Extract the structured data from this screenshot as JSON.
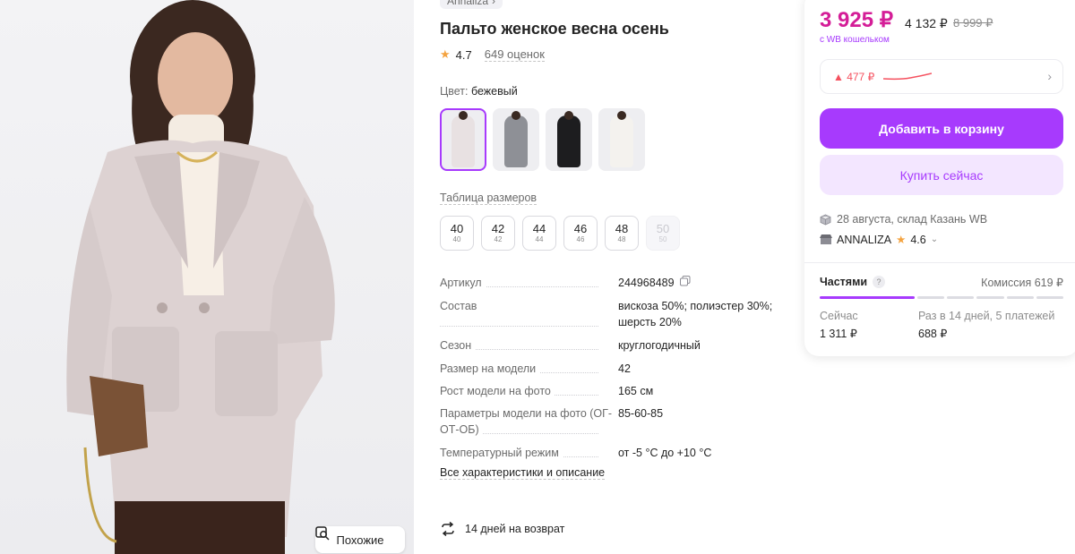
{
  "brand": {
    "name": "Annaliza"
  },
  "product": {
    "title": "Пальто женское весна осень",
    "rating": "4.7",
    "reviews": "649 оценок",
    "color_label": "Цвет:",
    "color_value": "бежевый"
  },
  "thumbs": [
    {
      "color": "#e8e1e2"
    },
    {
      "color": "#8e9096"
    },
    {
      "color": "#1d1d1f"
    },
    {
      "color": "#f4f2ee"
    }
  ],
  "size_table_link": "Таблица размеров",
  "sizes": [
    {
      "ru": "40",
      "eu": "40",
      "available": true
    },
    {
      "ru": "42",
      "eu": "42",
      "available": true
    },
    {
      "ru": "44",
      "eu": "44",
      "available": true
    },
    {
      "ru": "46",
      "eu": "46",
      "available": true
    },
    {
      "ru": "48",
      "eu": "48",
      "available": true
    },
    {
      "ru": "50",
      "eu": "50",
      "available": false
    }
  ],
  "specs": [
    {
      "key": "Артикул",
      "value": "244968489"
    },
    {
      "key": "Состав",
      "value": "вискоза 50%; полиэстер 30%; шерсть 20%"
    },
    {
      "key": "Сезон",
      "value": "круглогодичный"
    },
    {
      "key": "Размер на модели",
      "value": "42"
    },
    {
      "key": "Рост модели на фото",
      "value": "165 см"
    },
    {
      "key": "Параметры модели на фото (ОГ-ОТ-ОБ)",
      "value": "85-60-85"
    },
    {
      "key": "Температурный режим",
      "value": "от -5 °С до +10 °С"
    }
  ],
  "all_specs_link": "Все характеристики и описание",
  "returns": "14 дней на возврат",
  "similar_button": "Похожие",
  "price": {
    "current": "3 925 ₽",
    "without_wallet": "4 132 ₽",
    "old": "8 999 ₽",
    "wallet_note": "с WB кошельком",
    "change": "▲ 477 ₽"
  },
  "buttons": {
    "add_to_cart": "Добавить в корзину",
    "buy_now": "Купить сейчас"
  },
  "delivery": "28 августа, склад Казань WB",
  "seller": {
    "name": "ANNALIZA",
    "rating": "4.6"
  },
  "installments": {
    "label": "Частями",
    "help": "?",
    "commission": "Комиссия 619 ₽",
    "now_label": "Сейчас",
    "now_value": "1 311 ₽",
    "period_label": "Раз в 14 дней, 5 платежей",
    "period_value": "688 ₽",
    "paid_parts": 1,
    "total_parts": 6
  },
  "colors": {
    "accent": "#a73afd",
    "price": "#d41d97",
    "star": "#f4a340",
    "up": "#f5515f"
  }
}
